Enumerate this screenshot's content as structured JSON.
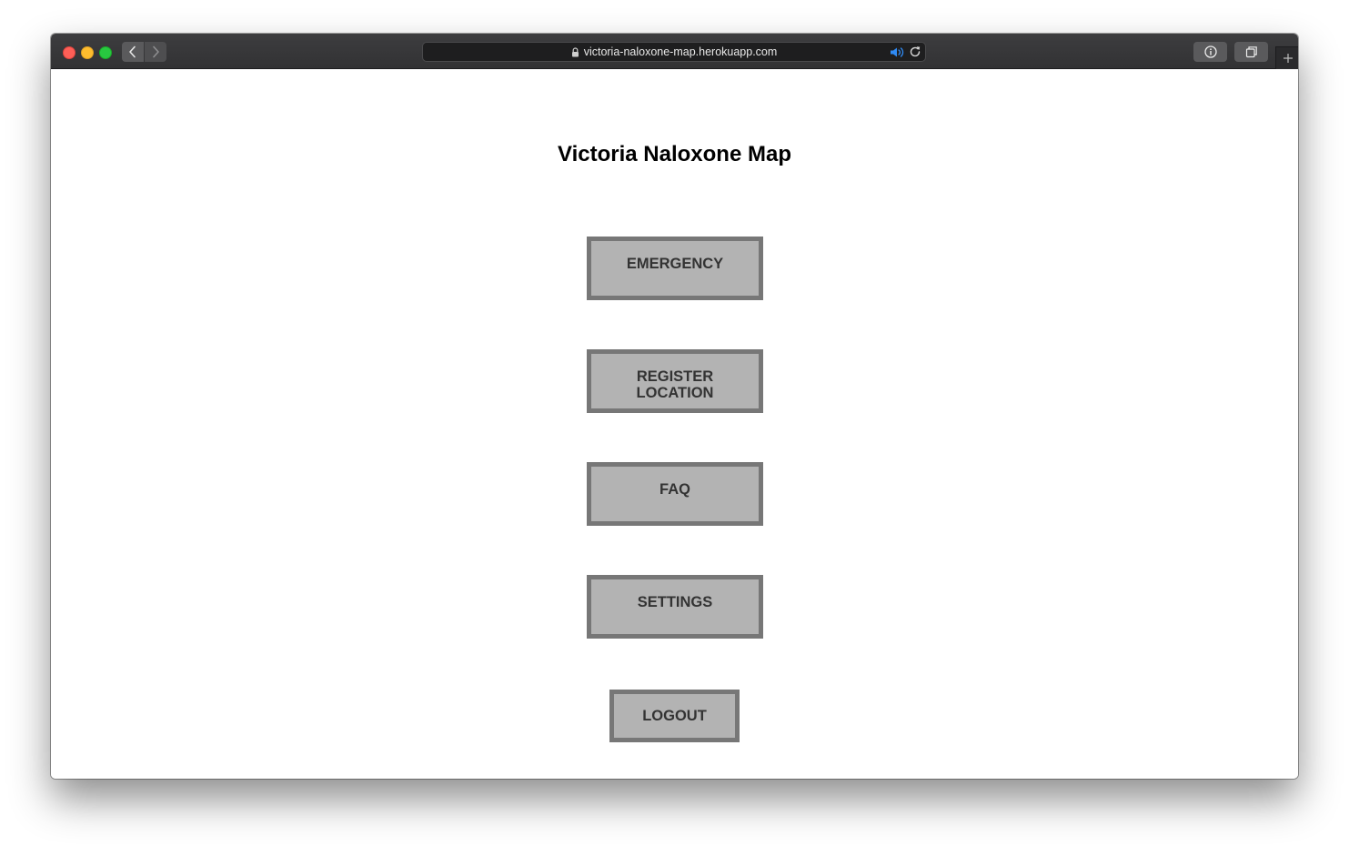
{
  "browser": {
    "url": "victoria-naloxone-map.herokuapp.com",
    "icons": {
      "close": "close-dot",
      "minimize": "minimize-dot",
      "maximize": "maximize-dot",
      "back": "chevron-left-icon",
      "forward": "chevron-right-icon",
      "lock": "lock-icon",
      "audio": "speaker-icon",
      "reload": "reload-icon",
      "info": "info-icon",
      "tabs": "tab-overview-icon",
      "new_tab": "plus-icon"
    },
    "colors": {
      "close": "#fe5f57",
      "minimize": "#febc2e",
      "maximize": "#28c840",
      "audio": "#2f8bf5"
    }
  },
  "page": {
    "title": "Victoria Naloxone Map",
    "buttons": {
      "emergency": "EMERGENCY",
      "register_location": "REGISTER LOCATION",
      "faq": "FAQ",
      "settings": "SETTINGS",
      "logout": "LOGOUT"
    },
    "colors": {
      "button_fill": "#b3b3b3",
      "button_border": "#777777",
      "button_text": "#333333"
    }
  }
}
